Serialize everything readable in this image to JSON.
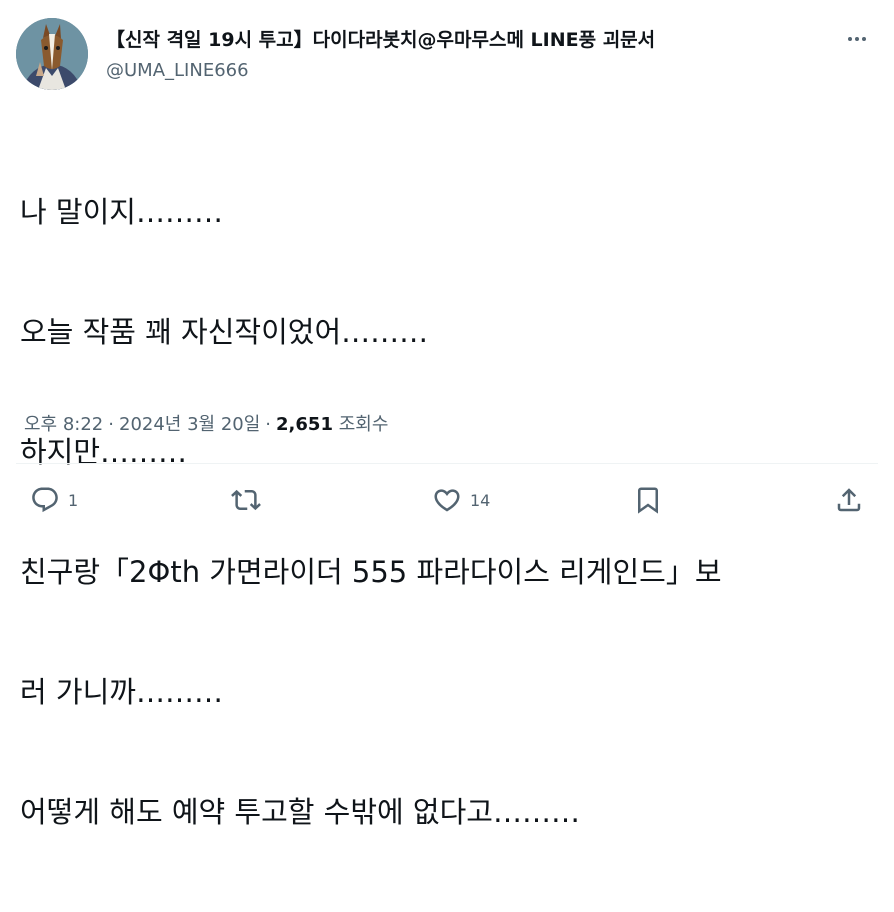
{
  "author": {
    "display_name": "【신작 격일 19시 투고】다이다라봇치@우마무스메 LINE풍 괴문서",
    "handle": "@UMA_LINE666",
    "avatar_icon": "horse-avatar"
  },
  "tweet": {
    "lines": [
      "나 말이지………",
      "오늘 작품 꽤 자신작이었어………",
      "하지만………",
      "친구랑「2Φth 가면라이더 555 파라다이스 리게인드」보",
      "러 가니까………",
      "어떻게 해도 예약 투고할 수밖에 없다고………"
    ]
  },
  "meta": {
    "time": "오후 8:22",
    "date": "2024년 3월 20일",
    "separator": "·",
    "views_count": "2,651",
    "views_label": "조회수"
  },
  "actions": {
    "reply_count": "1",
    "retweet_count": "",
    "like_count": "14"
  },
  "colors": {
    "text_primary": "#0f1419",
    "text_secondary": "#536471",
    "divider": "#eff3f4"
  }
}
